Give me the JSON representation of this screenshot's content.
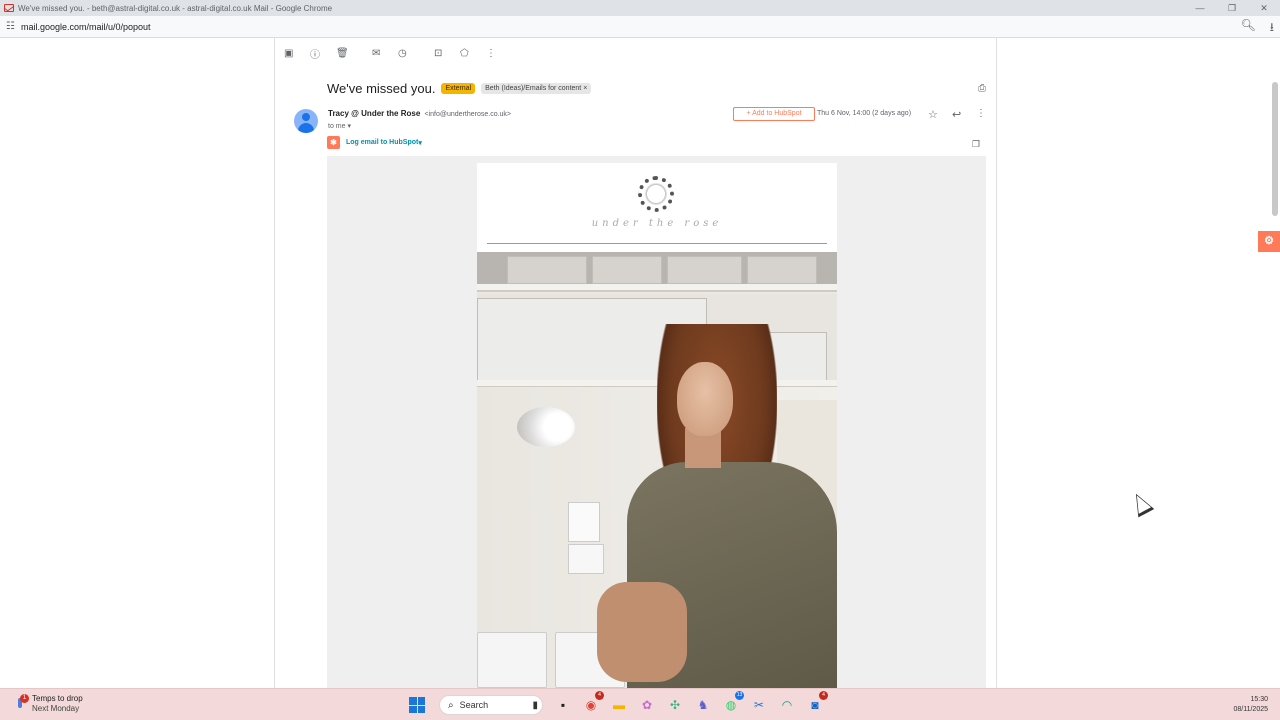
{
  "browser": {
    "window_title": "We've missed you. - beth@astral-digital.co.uk - astral-digital.co.uk Mail - Google Chrome",
    "url": "mail.google.com/mail/u/0/popout",
    "window_controls": {
      "minimize": "—",
      "restore": "❐",
      "close": "✕"
    }
  },
  "toolbar": {
    "icons": [
      "archive-icon",
      "report-spam-icon",
      "delete-icon",
      "mark-unread-icon",
      "snooze-icon",
      "move-to-icon",
      "label-icon",
      "more-vert-icon"
    ]
  },
  "email": {
    "subject": "We've missed you.",
    "badge_external": "External",
    "label_chip": "Beth (Ideas)/Emails for content",
    "label_chip_close": "×",
    "sender_name": "Tracy @ Under the Rose",
    "sender_email": "<info@undertherose.co.uk>",
    "recipient": "to me",
    "add_to_hubspot": "Add to HubSpot",
    "date": "Thu 6 Nov, 14:00 (2 days ago)",
    "log_hubspot": "Log email to HubSpot",
    "log_hubspot_arrow": "▾"
  },
  "newsletter": {
    "brand_script": "under the rose"
  },
  "taskbar": {
    "weather_title": "Temps to drop",
    "weather_sub": "Next Monday",
    "weather_badge": "1",
    "search_label": "Search",
    "chrome_badge": "4",
    "whatsapp_badge": "13",
    "other_badge": "4",
    "time": "15:30",
    "date": "08/11/2025"
  },
  "colors": {
    "hubspot_orange": "#ff7a59",
    "external_badge": "#f4b400",
    "taskbar_bg": "#f3d9d9"
  }
}
